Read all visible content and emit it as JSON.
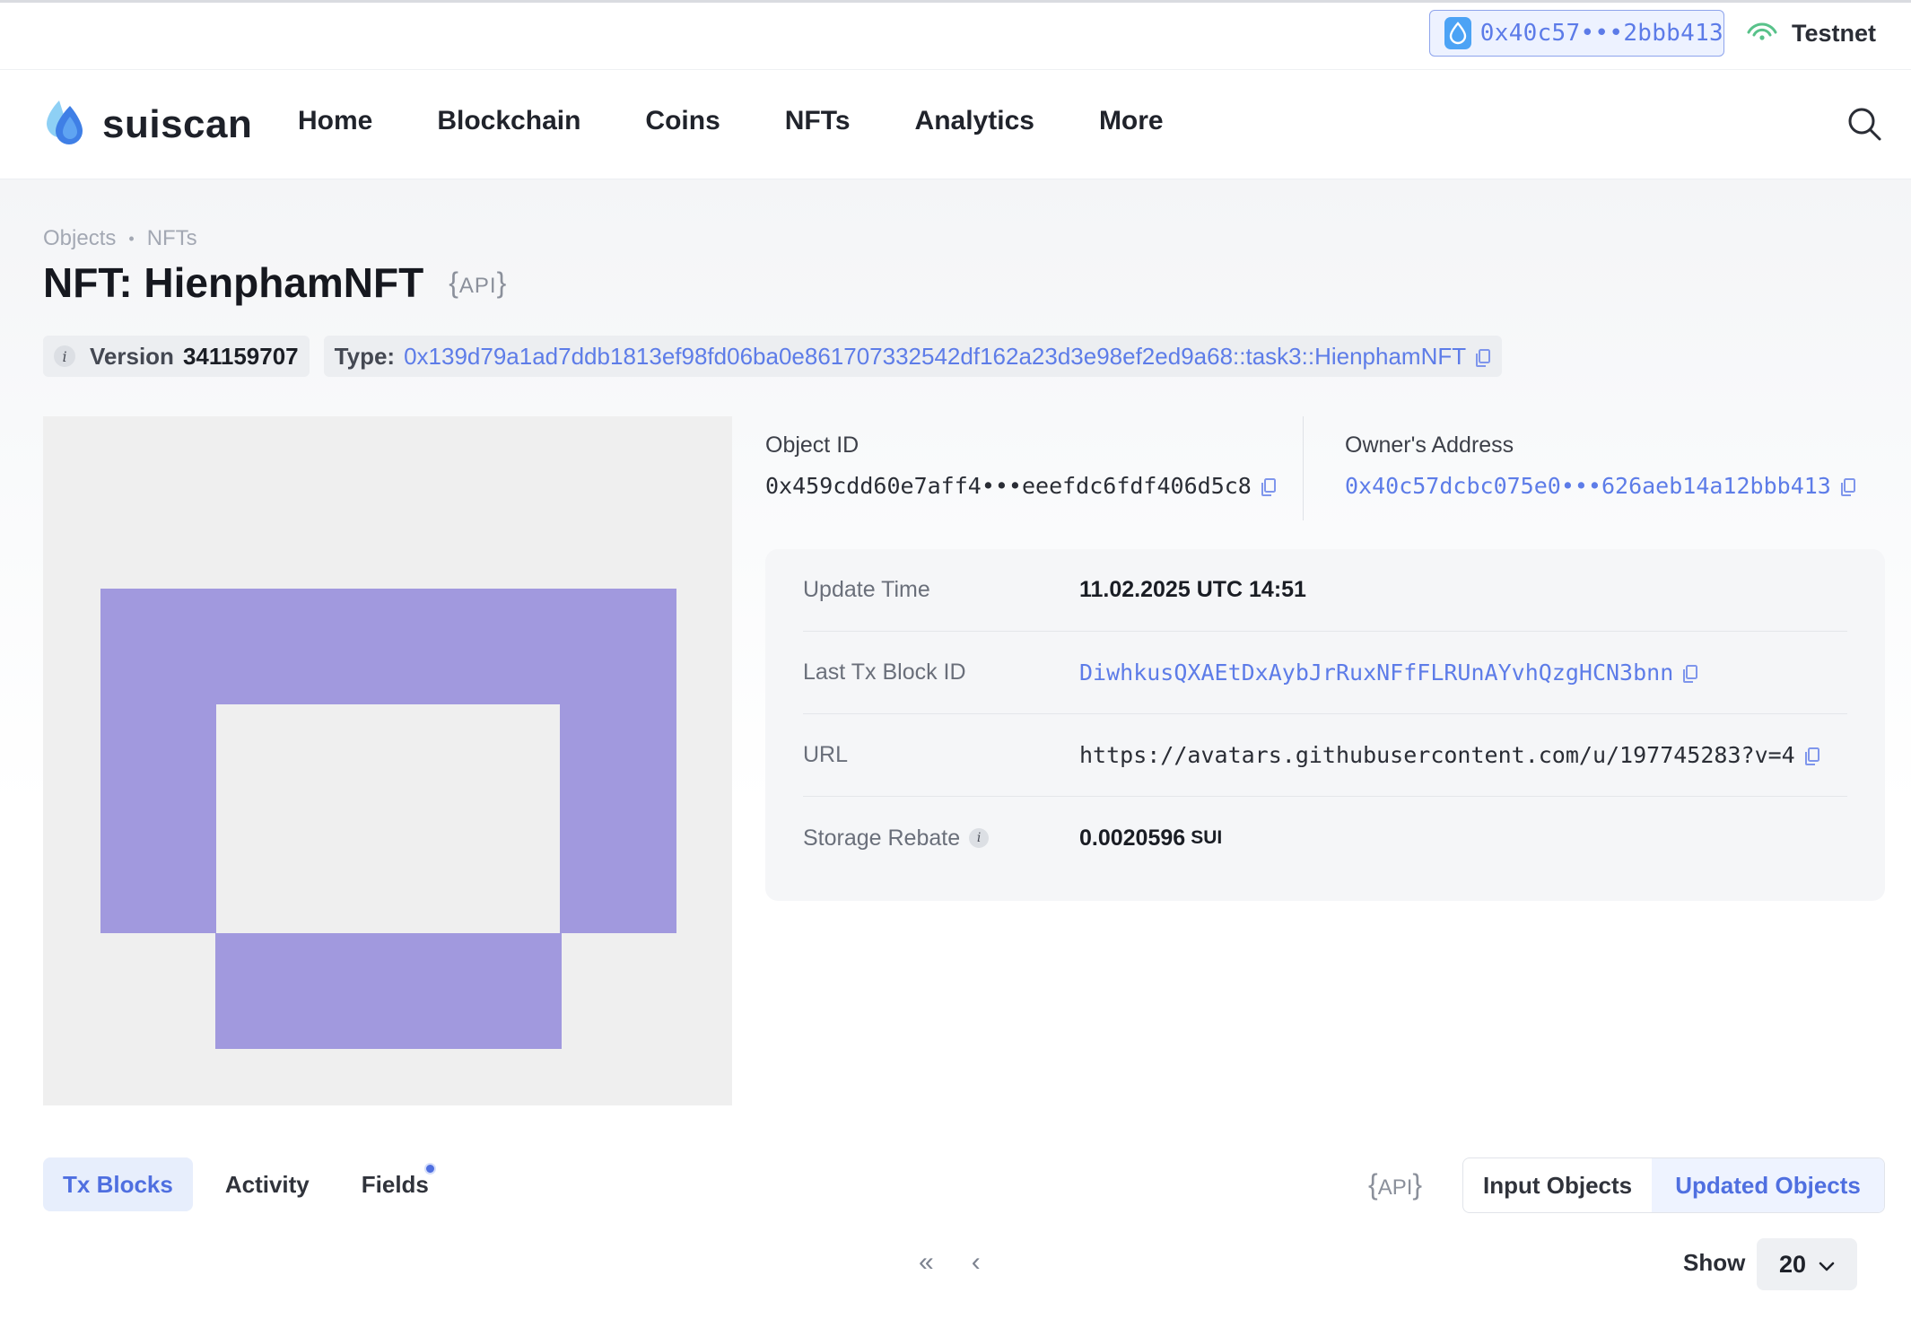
{
  "wallet": {
    "address": "0x40c57•••2bbb413"
  },
  "network": {
    "label": "Testnet"
  },
  "header": {
    "logo": "suiscan",
    "nav": [
      "Home",
      "Blockchain",
      "Coins",
      "NFTs",
      "Analytics",
      "More"
    ]
  },
  "breadcrumb": [
    "Objects",
    "NFTs"
  ],
  "title": "NFT: HienphamNFT",
  "api_label": "API",
  "meta": {
    "version_label": "Version",
    "version_value": "341159707",
    "type_label": "Type:",
    "type_value": "0x139d79a1ad7ddb1813ef98fd06ba0e861707332542df162a23d3e98ef2ed9a68::task3::HienphamNFT"
  },
  "object": {
    "id_label": "Object ID",
    "id_value": "0x459cdd60e7aff4•••eeefdc6fdf406d5c8",
    "owner_label": "Owner's Address",
    "owner_value": "0x40c57dcbc075e0•••626aeb14a12bbb413"
  },
  "details": [
    {
      "key": "Update Time",
      "value": "11.02.2025 UTC 14:51"
    },
    {
      "key": "Last Tx Block ID",
      "value": "DiwhkusQXAEtDxAybJrRuxNFfFLRUnAYvhQzgHCN3bnn"
    },
    {
      "key": "URL",
      "value": "https://avatars.githubusercontent.com/u/197745283?v=4"
    },
    {
      "key": "Storage Rebate",
      "value": "0.0020596",
      "unit": "SUI"
    }
  ],
  "tabs": [
    "Tx Blocks",
    "Activity",
    "Fields"
  ],
  "toggle": [
    "Input Objects",
    "Updated Objects"
  ],
  "pagination": {
    "first": "«",
    "prev": "‹"
  },
  "show": {
    "label": "Show",
    "value": "20"
  },
  "colors": {
    "accent": "#5d7ce8",
    "nft_purple": "#a199de",
    "nft_bg": "#efefef"
  }
}
